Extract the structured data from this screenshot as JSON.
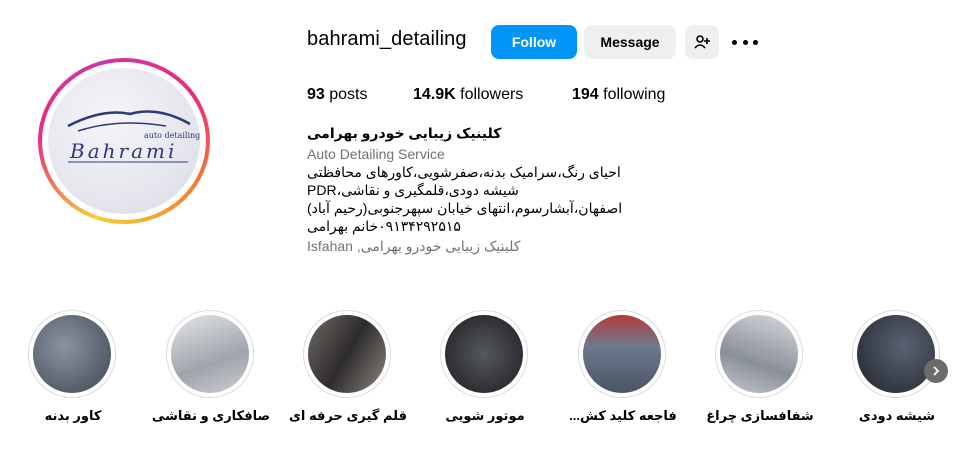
{
  "profile": {
    "username": "bahrami_detailing",
    "avatar_logo_text": "Bahrami",
    "avatar_logo_subtext": "auto detailing"
  },
  "actions": {
    "follow_label": "Follow",
    "message_label": "Message",
    "add_user_icon": "person-add-icon",
    "more_icon": "more-horizontal-icon"
  },
  "stats": {
    "posts_count": "93",
    "posts_label": "posts",
    "followers_count": "14.9K",
    "followers_label": "followers",
    "following_count": "194",
    "following_label": "following"
  },
  "bio": {
    "name": "کلینیک زیبایی خودرو بهرامی",
    "category": "Auto Detailing Service",
    "line1": "احیای رنگ،سرامیک بدنه،صفرشویی،کاورهای محافظتی",
    "line2": "شیشه دودی،قلمگیری و نقاشی،PDR",
    "line3": "اصفهان،آبشارسوم،انتهای خیابان سپهرجنوبی(رحیم آباد)",
    "line4": "۰۹۱۳۴۲۹۲۵۱۵خانم بهرامی",
    "location": "کلینیک زیبایی خودرو بهرامی, Isfahan"
  },
  "highlights": [
    {
      "label": "کاور بدنه",
      "color": "#5a6270"
    },
    {
      "label": "صافکاری و نقاشی",
      "color": "#b9bcc2"
    },
    {
      "label": "قلم گیری حرفه ای",
      "color": "#4e4b4a"
    },
    {
      "label": "موتور شویی",
      "color": "#2d2f33"
    },
    {
      "label": "فاجعه کلید کش...",
      "color": "#6d7a8e"
    },
    {
      "label": "شفافسازی چراغ",
      "color": "#a7adb6"
    },
    {
      "label": "شیشه دودی",
      "color": "#3a3f4a"
    }
  ],
  "colors": {
    "follow_blue": "#0095f6",
    "secondary_gray": "#efefef",
    "muted_text": "#737373"
  }
}
